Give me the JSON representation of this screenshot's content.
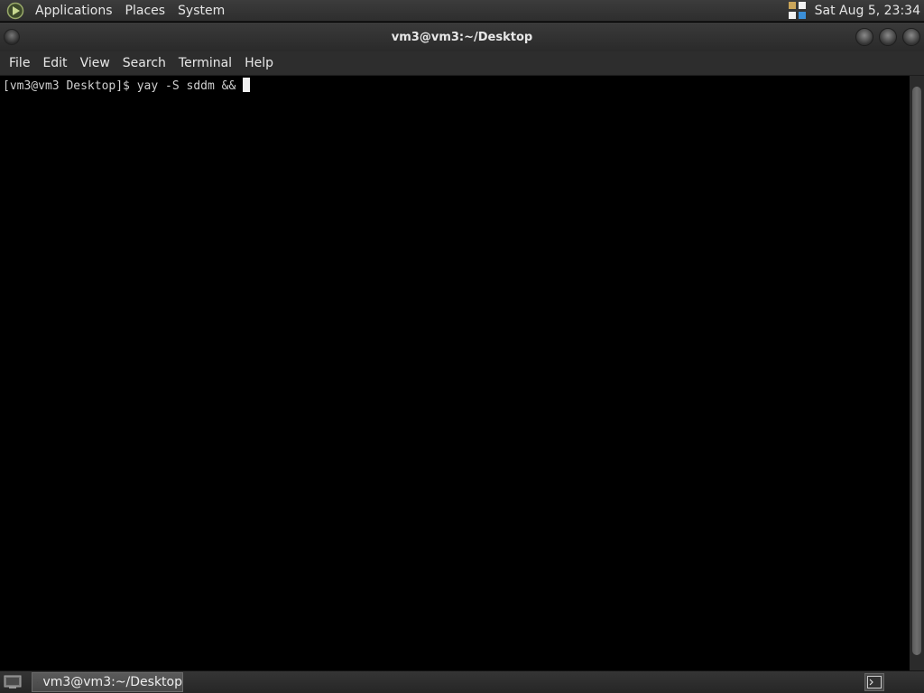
{
  "top_panel": {
    "menus": [
      "Applications",
      "Places",
      "System"
    ],
    "clock": "Sat Aug  5, 23:34"
  },
  "window": {
    "title": "vm3@vm3:~/Desktop",
    "menus": [
      "File",
      "Edit",
      "View",
      "Search",
      "Terminal",
      "Help"
    ]
  },
  "terminal": {
    "prompt": "[vm3@vm3 Desktop]$ ",
    "command": "yay -S sddm && "
  },
  "bottom_panel": {
    "task_label": "vm3@vm3:~/Desktop"
  },
  "colors": {
    "panel": "#2e2e2e",
    "terminal_bg": "#000000",
    "terminal_fg": "#d0d0d0"
  }
}
